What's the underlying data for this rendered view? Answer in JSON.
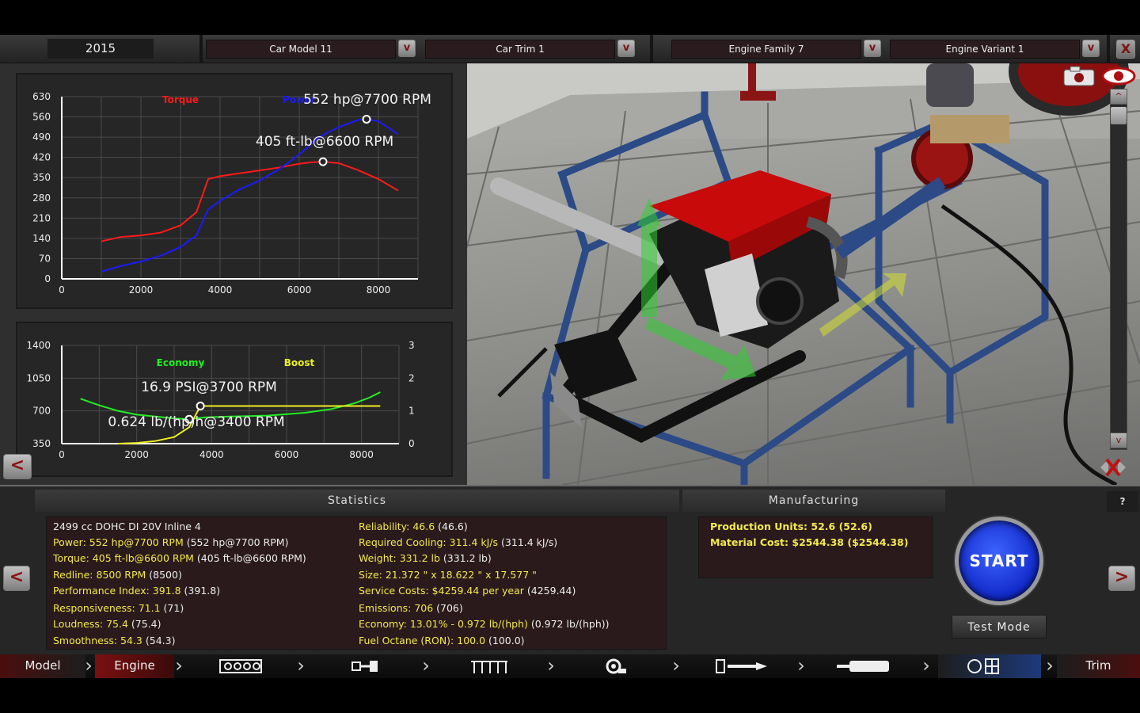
{
  "topbar": {
    "year": "2015",
    "car_model": "Car Model 11",
    "car_trim": "Car Trim 1",
    "engine_family": "Engine Family 7",
    "engine_variant": "Engine Variant 1",
    "dropdown_glyph": "v",
    "close_glyph": "X"
  },
  "graphs": {
    "back_glyph": "<"
  },
  "chart_data": [
    {
      "type": "line",
      "x_ticks": [
        "0",
        "2000",
        "4000",
        "6000",
        "8000"
      ],
      "y_ticks": [
        "0",
        "70",
        "140",
        "210",
        "280",
        "350",
        "420",
        "490",
        "560",
        "630"
      ],
      "xlim": [
        0,
        9000
      ],
      "ylim": [
        0,
        630
      ],
      "grid": true,
      "series": [
        {
          "name": "Torque",
          "color": "#ff1a1a",
          "x": [
            1000,
            1500,
            2000,
            2500,
            3000,
            3400,
            3700,
            4000,
            4500,
            5000,
            5500,
            6000,
            6300,
            6600,
            7000,
            7500,
            8000,
            8500
          ],
          "y": [
            130,
            145,
            150,
            160,
            185,
            230,
            345,
            355,
            365,
            375,
            385,
            398,
            403,
            405,
            400,
            375,
            345,
            305
          ]
        },
        {
          "name": "Power",
          "color": "#1a1aff",
          "x": [
            1000,
            1500,
            2000,
            2500,
            3000,
            3400,
            3700,
            4000,
            4500,
            5000,
            5500,
            6000,
            6500,
            7000,
            7500,
            7700,
            8000,
            8500
          ],
          "y": [
            25,
            45,
            60,
            80,
            110,
            150,
            240,
            270,
            310,
            340,
            380,
            430,
            490,
            525,
            550,
            552,
            545,
            500
          ]
        }
      ],
      "annotations": [
        "552 hp@7700 RPM",
        "405 ft-lb@6600 RPM"
      ],
      "markers": [
        {
          "series": "Power",
          "x": 7700,
          "y": 552
        },
        {
          "series": "Torque",
          "x": 6600,
          "y": 405
        }
      ]
    },
    {
      "type": "line",
      "x_ticks": [
        "0",
        "2000",
        "4000",
        "6000",
        "8000"
      ],
      "y_ticks_left": [
        "350",
        "700",
        "1050",
        "1400"
      ],
      "y_ticks_right": [
        "0",
        "1",
        "2",
        "3"
      ],
      "xlim": [
        0,
        9000
      ],
      "ylim_left": [
        350,
        1400
      ],
      "ylim_right": [
        0,
        3
      ],
      "grid": true,
      "series": [
        {
          "name": "Economy",
          "color": "#22ee22",
          "axis": "left",
          "x": [
            500,
            1000,
            1500,
            2000,
            2500,
            3000,
            3400,
            3800,
            4500,
            5500,
            6500,
            7200,
            7800,
            8200,
            8500
          ],
          "y": [
            830,
            760,
            700,
            660,
            640,
            620,
            610,
            630,
            640,
            650,
            680,
            720,
            780,
            840,
            900
          ]
        },
        {
          "name": "Boost",
          "color": "#eeee22",
          "axis": "right",
          "x": [
            1500,
            2000,
            2500,
            3000,
            3400,
            3700,
            4000,
            5000,
            6000,
            7000,
            8000,
            8500
          ],
          "y": [
            0,
            0.02,
            0.08,
            0.2,
            0.5,
            1.15,
            1.15,
            1.15,
            1.15,
            1.15,
            1.15,
            1.15
          ]
        }
      ],
      "annotations": [
        "16.9 PSI@3700 RPM",
        "0.624 lb/(hp)h@3400 RPM"
      ],
      "markers": [
        {
          "series": "Boost",
          "x": 3700,
          "y": 1.15
        },
        {
          "series": "Economy",
          "x": 3400,
          "y": 610
        }
      ]
    }
  ],
  "viewport": {
    "camera_icon": "camera-icon",
    "eye_icon": "eye-icon",
    "scroll_up": "^",
    "scroll_down": "v"
  },
  "statistics": {
    "title": "Statistics",
    "left": [
      {
        "label": "2499 cc DOHC DI 20V Inline 4",
        "value": ""
      },
      {
        "label": "Power: 552 hp@7700 RPM",
        "value": " (552 hp@7700 RPM)"
      },
      {
        "label": "Torque: 405 ft-lb@6600 RPM",
        "value": " (405 ft-lb@6600 RPM)"
      },
      {
        "label": "Redline: 8500 RPM",
        "value": " (8500)"
      },
      {
        "label": "Performance Index: 391.8",
        "value": " (391.8)"
      },
      {
        "label": "Responsiveness: 71.1",
        "value": " (71)"
      },
      {
        "label": "Loudness: 75.4",
        "value": " (75.4)"
      },
      {
        "label": "Smoothness: 54.3",
        "value": " (54.3)"
      }
    ],
    "right": [
      {
        "label": "Reliability: 46.6",
        "value": " (46.6)"
      },
      {
        "label": "Required Cooling: 311.4 kJ/s",
        "value": " (311.4 kJ/s)"
      },
      {
        "label": "Weight: 331.2 lb",
        "value": " (331.2 lb)"
      },
      {
        "label": "Size: 21.372 \" x 18.622 \" x 17.577 \"",
        "value": ""
      },
      {
        "label": "Service Costs: $4259.44 per year",
        "value": " (4259.44)"
      },
      {
        "label": "Emissions: 706",
        "value": " (706)"
      },
      {
        "label": "Economy: 13.01% - 0.972 lb/(hph)",
        "value": " (0.972 lb/(hph))"
      },
      {
        "label": "Fuel Octane (RON): 100.0",
        "value": " (100.0)"
      }
    ]
  },
  "manufacturing": {
    "title": "Manufacturing",
    "lines": [
      {
        "label": "Production Units: 52.6",
        "value": " (52.6)"
      },
      {
        "label": "Material Cost: $2544.38",
        "value": " ($2544.38)"
      }
    ],
    "help": "?"
  },
  "actions": {
    "start": "START",
    "test_mode": "Test Mode",
    "prev": "<",
    "next": ">"
  },
  "navbar": {
    "items": [
      {
        "label": "Model"
      },
      {
        "label": "Engine"
      },
      {
        "icon": "block-icon"
      },
      {
        "icon": "crank-icon"
      },
      {
        "icon": "valvetrain-icon"
      },
      {
        "icon": "turbo-icon"
      },
      {
        "icon": "fuel-icon"
      },
      {
        "icon": "exhaust-icon"
      },
      {
        "icon": "gauge-icon"
      },
      {
        "label": "Trim"
      }
    ]
  }
}
